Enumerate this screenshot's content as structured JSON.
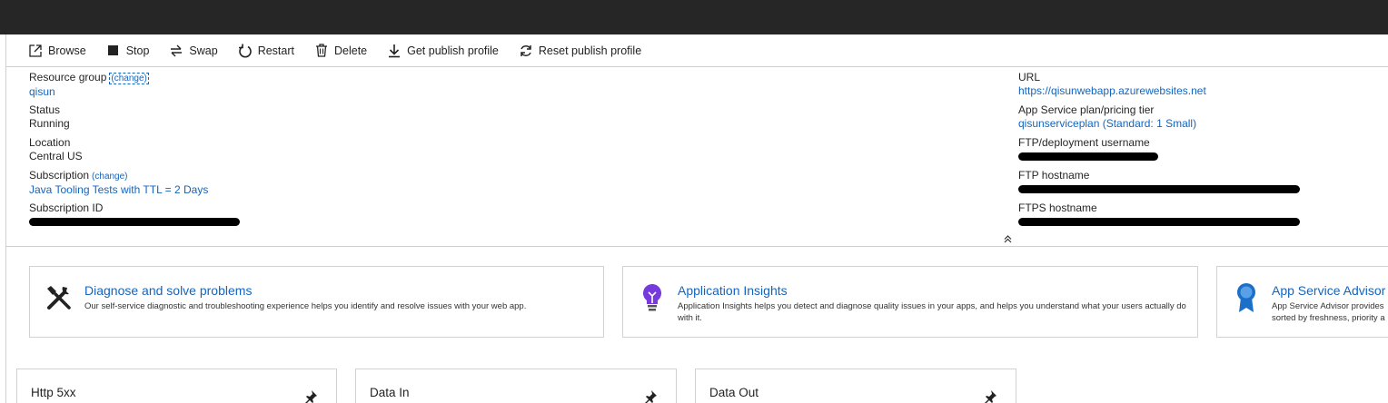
{
  "toolbar": {
    "browse": "Browse",
    "stop": "Stop",
    "swap": "Swap",
    "restart": "Restart",
    "delete": "Delete",
    "get_publish_profile": "Get publish profile",
    "reset_publish_profile": "Reset publish profile"
  },
  "essentials": {
    "resource_group": {
      "label": "Resource group",
      "change": "(change)",
      "value": "qisun"
    },
    "status": {
      "label": "Status",
      "value": "Running"
    },
    "location": {
      "label": "Location",
      "value": "Central US"
    },
    "subscription": {
      "label": "Subscription",
      "change": "(change)",
      "value": "Java Tooling Tests with TTL = 2 Days"
    },
    "subscription_id": {
      "label": "Subscription ID"
    },
    "url": {
      "label": "URL",
      "value": "https://qisunwebapp.azurewebsites.net"
    },
    "plan": {
      "label": "App Service plan/pricing tier",
      "value": "qisunserviceplan (Standard: 1 Small)"
    },
    "ftp_user": {
      "label": "FTP/deployment username"
    },
    "ftp_host": {
      "label": "FTP hostname"
    },
    "ftps_host": {
      "label": "FTPS hostname"
    },
    "collapse_glyph": "⌃"
  },
  "cards": [
    {
      "title": "Diagnose and solve problems",
      "desc": "Our self-service diagnostic and troubleshooting experience helps you identify and resolve issues with your web app.",
      "icon": "tools-icon"
    },
    {
      "title": "Application Insights",
      "desc": "Application Insights helps you detect and diagnose quality issues in your apps, and helps you understand what your users actually do with it.",
      "icon": "lightbulb-icon"
    },
    {
      "title": "App Service Advisor",
      "desc": "App Service Advisor provides sorted by freshness, priority a",
      "icon": "ribbon-icon"
    }
  ],
  "tiles": [
    {
      "title": "Http 5xx"
    },
    {
      "title": "Data In"
    },
    {
      "title": "Data Out"
    }
  ],
  "colors": {
    "link": "#1465c0",
    "topbar": "#262626",
    "lightbulb": "#773adc",
    "ribbon": "#1b6fc9"
  }
}
